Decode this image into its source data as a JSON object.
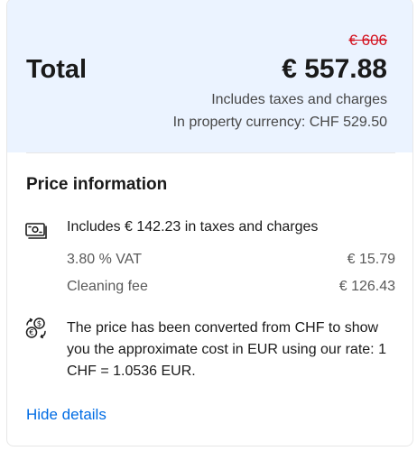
{
  "summary": {
    "old_price": "€ 606",
    "total_label": "Total",
    "total_value": "€ 557.88",
    "taxes_note": "Includes taxes and charges",
    "currency_note": "In property currency: CHF 529.50",
    "colors": {
      "background": "#ebf3ff",
      "old_price": "#d4111e"
    }
  },
  "price_info": {
    "title": "Price information",
    "tax_summary": {
      "icon": "cash-icon",
      "text": "Includes € 142.23 in taxes and charges"
    },
    "lines": [
      {
        "label": "3.80 % VAT",
        "value": "€ 15.79"
      },
      {
        "label": "Cleaning fee",
        "value": "€ 126.43"
      }
    ],
    "conversion": {
      "icon": "currency-exchange-icon",
      "text": "The price has been converted from CHF to show you the approximate cost in EUR using our rate: 1 CHF = 1.0536 EUR."
    }
  },
  "actions": {
    "hide_details": "Hide details",
    "link_color": "#006ce4"
  }
}
